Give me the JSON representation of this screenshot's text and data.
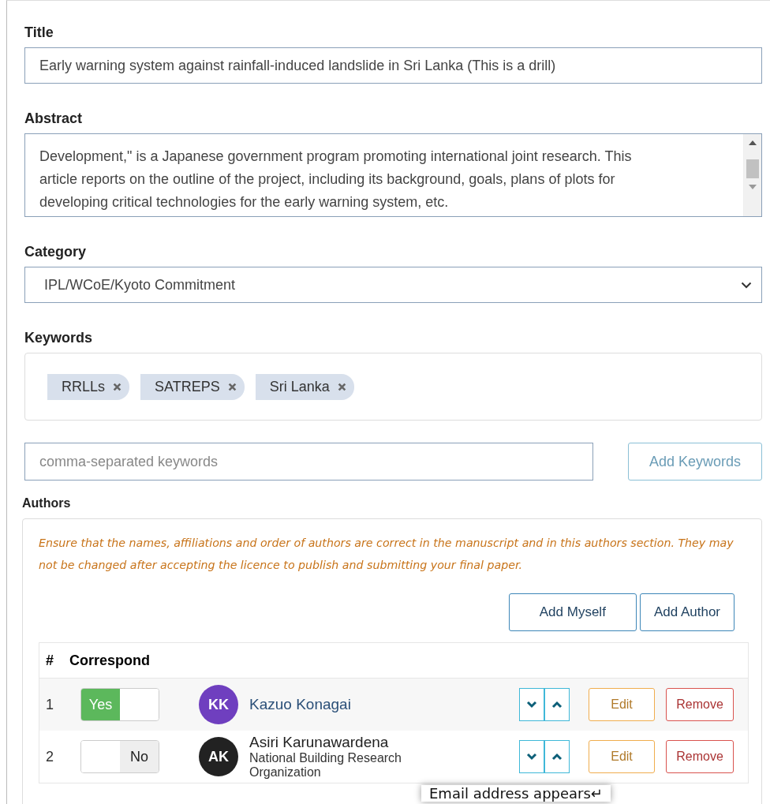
{
  "title": {
    "label": "Title",
    "value": "Early warning system against rainfall-induced landslide in Sri Lanka (This is a drill)"
  },
  "abstract": {
    "label": "Abstract",
    "lines": [
      "Development,\" is a Japanese government program promoting international joint research. This",
      "article reports on the outline of the project, including its background, goals, plans of plots for",
      "developing critical technologies for the early warning system, etc."
    ]
  },
  "category": {
    "label": "Category",
    "value": "IPL/WCoE/Kyoto Commitment"
  },
  "keywords": {
    "label": "Keywords",
    "tags": [
      "RRLLs",
      "SATREPS",
      "Sri Lanka"
    ],
    "input": {
      "placeholder": "comma-separated keywords"
    },
    "add_button": "Add Keywords"
  },
  "authors": {
    "label": "Authors",
    "notice": "Ensure that the names, affiliations and order of authors are correct in the manuscript and in this authors section. They may not be changed after accepting the licence to publish and submitting your final paper.",
    "buttons": [
      "Add Myself",
      "Add Author"
    ],
    "table": {
      "columns": [
        "#",
        "Correspond"
      ],
      "rows": [
        {
          "number": "1",
          "correspond": {
            "on": true,
            "label": "Yes"
          },
          "initials": "KK",
          "color": "#6f3fbf",
          "name": "Kazuo Konagai",
          "affiliation": "",
          "actions": [
            "Edit",
            "Remove"
          ]
        },
        {
          "number": "2",
          "correspond": {
            "on": false,
            "label": "No"
          },
          "initials": "AK",
          "color": "#222222",
          "name": "Asiri Karunawardena",
          "affiliation": "National Building Research Organization",
          "actions": [
            "Edit",
            "Remove"
          ]
        }
      ]
    }
  },
  "tooltip": "Email address appears↵"
}
